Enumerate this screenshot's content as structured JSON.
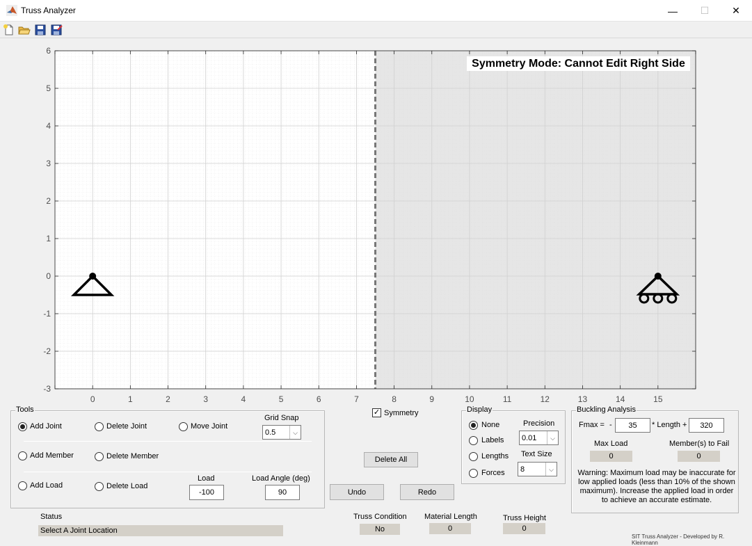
{
  "window": {
    "title": "Truss Analyzer",
    "minimize": "—",
    "maximize": "☐",
    "close": "✕"
  },
  "toolbar": {
    "icons": [
      "new-file-icon",
      "open-folder-icon",
      "save-icon",
      "save-as-icon"
    ]
  },
  "plot": {
    "banner": "Symmetry Mode: Cannot Edit Right Side",
    "x_ticks": [
      "0",
      "1",
      "2",
      "3",
      "4",
      "5",
      "6",
      "7",
      "8",
      "9",
      "10",
      "11",
      "12",
      "13",
      "14",
      "15"
    ],
    "y_ticks": [
      "6",
      "5",
      "4",
      "3",
      "2",
      "1",
      "0",
      "-1",
      "-2",
      "-3"
    ],
    "xlim": [
      -1,
      16
    ],
    "ylim": [
      -3,
      6
    ],
    "symmetry_line_x": 7.5,
    "pin_support": {
      "x": 0,
      "y": 0
    },
    "roller_support": {
      "x": 15,
      "y": 0
    },
    "locked_region_color": "#e6e6e6"
  },
  "tools": {
    "title": "Tools",
    "add_joint": "Add Joint",
    "delete_joint": "Delete Joint",
    "move_joint": "Move Joint",
    "grid_snap_label": "Grid Snap",
    "grid_snap_value": "0.5",
    "add_member": "Add Member",
    "delete_member": "Delete Member",
    "add_load": "Add Load",
    "delete_load": "Delete Load",
    "load_label": "Load",
    "load_value": "-100",
    "load_angle_label": "Load Angle (deg)",
    "load_angle_value": "90",
    "selected": "add_joint"
  },
  "middle": {
    "symmetry_label": "Symmetry",
    "symmetry_checked": true,
    "delete_all": "Delete All",
    "undo": "Undo",
    "redo": "Redo"
  },
  "display": {
    "title": "Display",
    "none": "None",
    "labels": "Labels",
    "lengths": "Lengths",
    "forces": "Forces",
    "precision_label": "Precision",
    "precision_value": "0.01",
    "text_size_label": "Text Size",
    "text_size_value": "8",
    "selected": "none"
  },
  "buckling": {
    "title": "Buckling Analysis",
    "fmax_label": "Fmax =",
    "minus": "-",
    "coef_value": "35",
    "length_label": "* Length +",
    "const_value": "320",
    "max_load_label": "Max Load",
    "max_load_value": "0",
    "members_fail_label": "Member(s) to Fail",
    "members_fail_value": "0",
    "warning": "Warning: Maximum load may be inaccurate for low applied loads (less than 10% of the shown maximum). Increase the applied load in order to achieve an accurate estimate."
  },
  "status": {
    "label": "Status",
    "value": "Select A Joint Location",
    "truss_condition_label": "Truss Condition",
    "truss_condition_value": "No",
    "material_length_label": "Material Length",
    "material_length_value": "0",
    "truss_height_label": "Truss Height",
    "truss_height_value": "0"
  },
  "footer": {
    "credit": "SIT Truss Analyzer - Developed by R. Kleinmann"
  }
}
